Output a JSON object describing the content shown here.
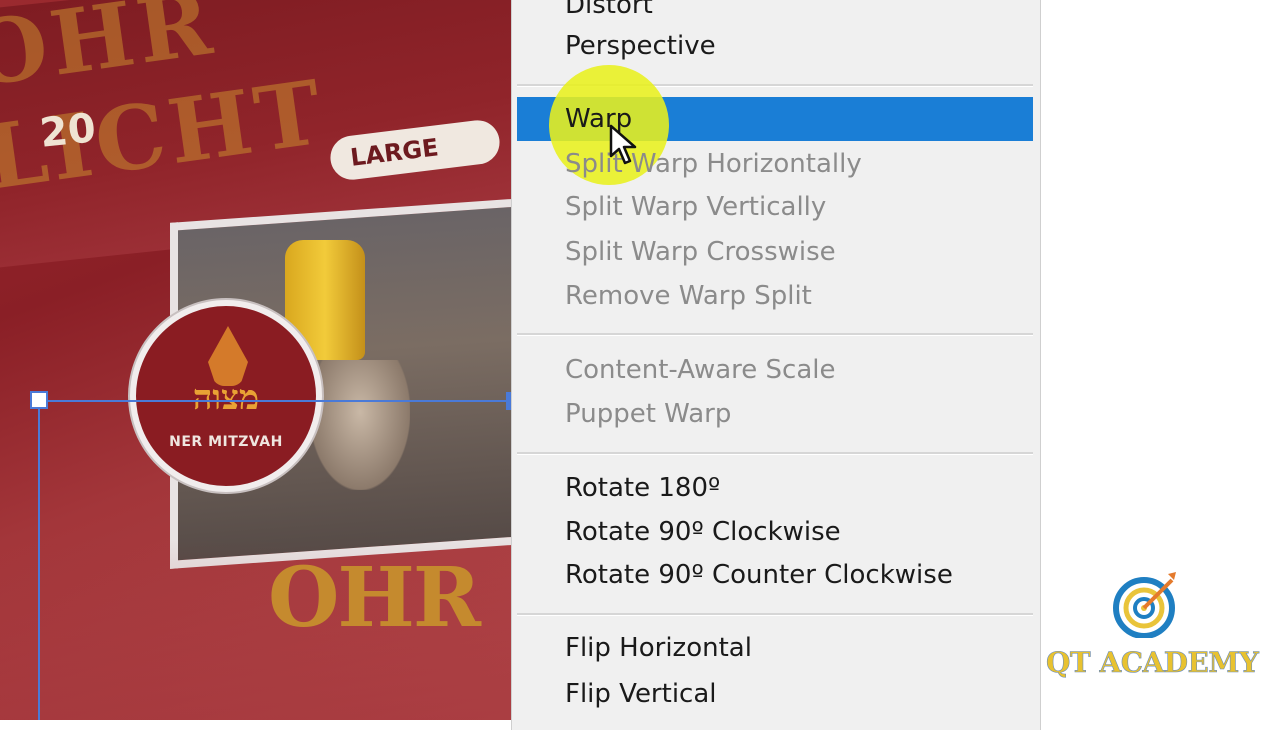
{
  "canvas": {
    "brand_top": "OHR LICHT",
    "count": "20",
    "badge": "LARGE",
    "seal_hebrew": "מצוה",
    "seal_text": "NER MITZVAH",
    "brand_bottom": "OHR"
  },
  "menu": {
    "items_group1": [
      "Distort",
      "Perspective"
    ],
    "selected": "Warp",
    "warp_group": [
      "Split Warp Horizontally",
      "Split Warp Vertically",
      "Split Warp Crosswise",
      "Remove Warp Split"
    ],
    "aware_group": [
      "Content-Aware Scale",
      "Puppet Warp"
    ],
    "rotate_group": [
      "Rotate 180º",
      "Rotate 90º Clockwise",
      "Rotate 90º Counter Clockwise"
    ],
    "flip_group": [
      "Flip Horizontal",
      "Flip Vertical"
    ]
  },
  "logo": {
    "name": "QT ACADEMY"
  },
  "colors": {
    "menu_bg": "#f0f0f0",
    "selection": "#1a7ed6",
    "highlight": "#e8f01e",
    "guide": "#4a7ad8"
  }
}
